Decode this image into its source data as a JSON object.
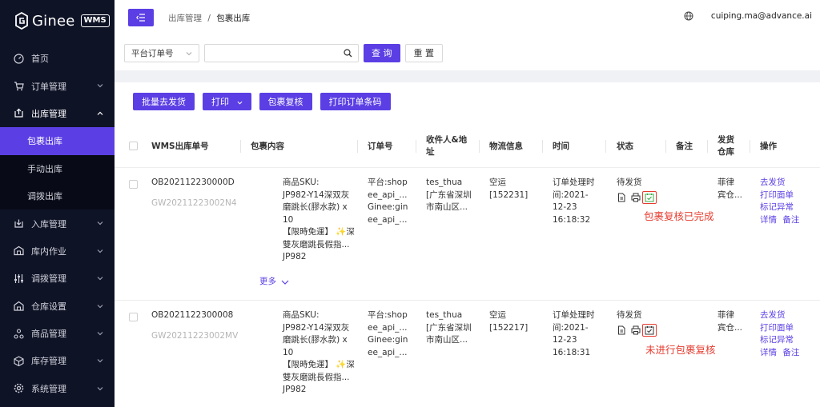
{
  "brand": {
    "name": "Ginee",
    "badge": "WMS"
  },
  "sidebar": {
    "items": [
      {
        "label": "首页",
        "icon": "dashboard-icon"
      },
      {
        "label": "订单管理",
        "icon": "cart-icon"
      },
      {
        "label": "出库管理",
        "icon": "outbound-icon",
        "sub": [
          "包裹出库",
          "手动出库",
          "调拨出库"
        ]
      },
      {
        "label": "入库管理",
        "icon": "inbound-icon"
      },
      {
        "label": "库内作业",
        "icon": "warehouse-ops-icon"
      },
      {
        "label": "调拨管理",
        "icon": "transfer-icon"
      },
      {
        "label": "仓库设置",
        "icon": "warehouse-settings-icon"
      },
      {
        "label": "商品管理",
        "icon": "product-icon"
      },
      {
        "label": "库存管理",
        "icon": "inventory-icon"
      },
      {
        "label": "系统管理",
        "icon": "system-gear-icon"
      }
    ]
  },
  "topbar": {
    "breadcrumb_parent": "出库管理",
    "breadcrumb_sep": "/",
    "breadcrumb_current": "包裹出库",
    "user_email": "cuiping.ma@advance.ai"
  },
  "filter": {
    "select_value": "平台订单号",
    "search_value": "",
    "query_label": "查 询",
    "reset_label": "重 置"
  },
  "actions": {
    "batch_ship": "批量去发货",
    "print": "打印",
    "package_review": "包裹复核",
    "print_barcode": "打印订单条码"
  },
  "table": {
    "headers": {
      "wms_no": "WMS出库单号",
      "content": "包裹内容",
      "order_no": "订单号",
      "receiver_l1": "收件人&地",
      "receiver_l2": "址",
      "logistics": "物流信息",
      "time": "时间",
      "status": "状态",
      "remark": "备注",
      "warehouse_l1": "发货",
      "warehouse_l2": "仓库",
      "operation": "操作"
    },
    "rows": [
      {
        "wms_no": "OB202112230000D",
        "sub_no": "GW20211223002N4",
        "content": [
          "商品SKU:",
          "JP982-Y14深双灰",
          "磨跳长(膠水款) x",
          "10",
          "【限時免運】 ✨深",
          "雙灰磨跳長假指...",
          "JP982"
        ],
        "more": "更多",
        "order": [
          "平台:shop",
          "ee_api_...",
          "Ginee:gin",
          "ee_api_..."
        ],
        "receiver": [
          "tes_thua",
          "[广东省深圳",
          "市南山区..."
        ],
        "logistics": [
          "空运",
          "[152231]"
        ],
        "time": [
          "订单处理时",
          "间:2021-",
          "12-23",
          "16:18:32"
        ],
        "status": "待发货",
        "warehouse": [
          "菲律",
          "宾仓..."
        ],
        "ops": [
          "去发货",
          "打印面单",
          "标记异常",
          "详情",
          "备注"
        ],
        "annotation": "包裹复核已完成"
      },
      {
        "wms_no": "OB2021122300008",
        "sub_no": "GW20211223002MV",
        "content": [
          "商品SKU:",
          "JP982-Y14深双灰",
          "磨跳长(膠水款) x",
          "10",
          "【限時免運】 ✨深",
          "雙灰磨跳長假指...",
          "JP982"
        ],
        "order": [
          "平台:shop",
          "ee_api_...",
          "Ginee:gin",
          "ee_api_..."
        ],
        "receiver": [
          "tes_thua",
          "[广东省深圳",
          "市南山区..."
        ],
        "logistics": [
          "空运",
          "[152217]"
        ],
        "time": [
          "订单处理时",
          "间:2021-",
          "12-23",
          "16:18:31"
        ],
        "status": "待发货",
        "warehouse": [
          "菲律",
          "宾仓..."
        ],
        "ops": [
          "去发货",
          "打印面单",
          "标记异常",
          "详情",
          "备注"
        ],
        "annotation": "未进行包裹复核"
      }
    ]
  },
  "colors": {
    "accent": "#5b3fe4",
    "sidebar_bg": "#0f1326",
    "annotation": "#e63b2e",
    "review_done": "#3aa745"
  }
}
